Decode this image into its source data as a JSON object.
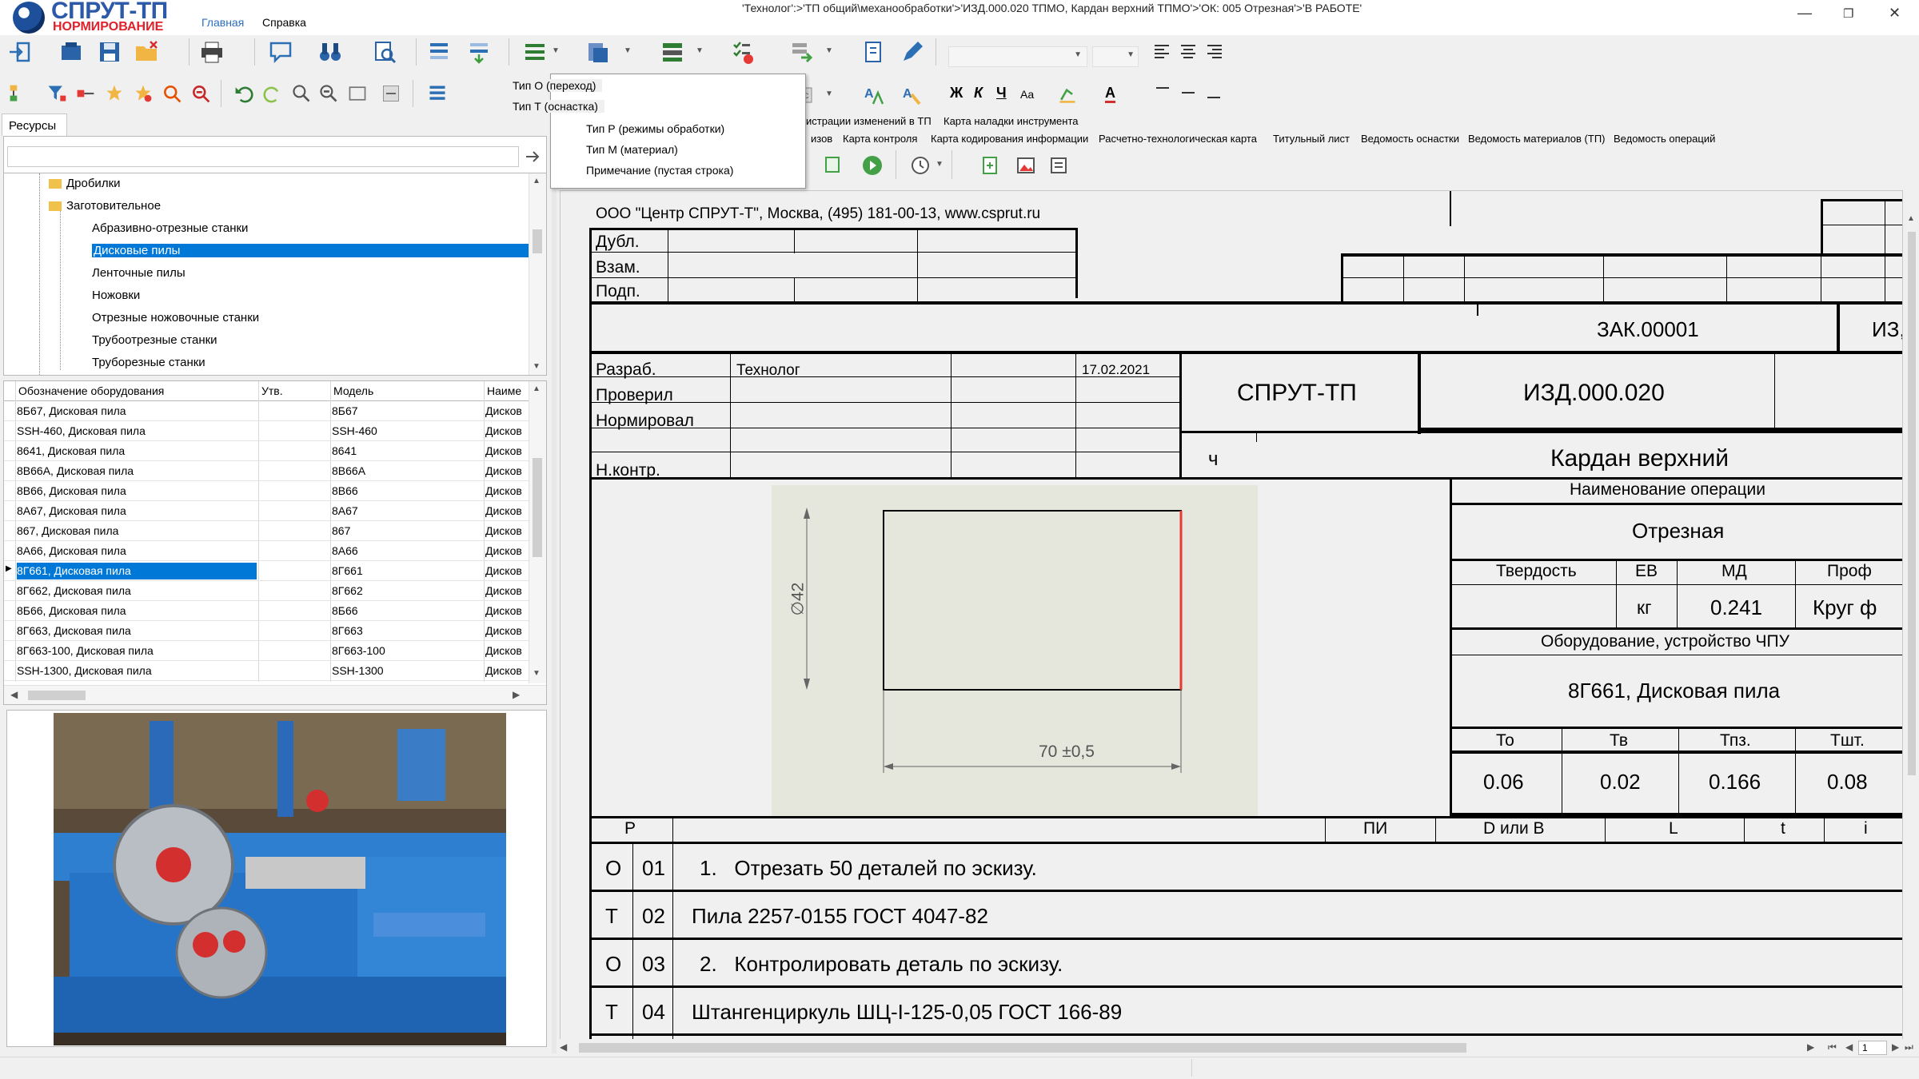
{
  "app": {
    "logo_title": "СПРУТ-ТП",
    "logo_subtitle": "НОРМИРОВАНИЕ",
    "menu": [
      "Главная",
      "Справка"
    ],
    "window_title": "'Технолог':>'ТП общий\\механообработки'>'ИЗД.000.020 ТПМО, Кардан верхний ТПМО'>'ОК: 005 Отрезная'>'В РАБОТЕ'",
    "window_controls": [
      "—",
      "❐",
      "✕"
    ]
  },
  "toolbar": {
    "format_labels": [
      "Ж",
      "К",
      "Ч",
      "Aa",
      "A"
    ]
  },
  "dropdown": {
    "items": [
      "Тип О (переход)",
      "Тип Т (оснастка)",
      "Тип Р (режимы обработки)",
      "Тип М (материал)",
      "Примечание (пустая строка)"
    ]
  },
  "tabs": {
    "row1": [
      "истрации изменений в ТП",
      "Карта наладки инструмента"
    ],
    "row2": [
      "изов",
      "Карта контроля",
      "Карта кодирования информации",
      "Расчетно-технологическая карта",
      "Титульный лист",
      "Ведомость оснастки",
      "Ведомость материалов (ТП)",
      "Ведомость операций"
    ]
  },
  "resources": {
    "tab_label": "Ресурсы",
    "search_value": "",
    "tree": [
      {
        "label": "Дробилки",
        "level": 1,
        "folder": true
      },
      {
        "label": "Заготовительное",
        "level": 1,
        "folder": true
      },
      {
        "label": "Абразивно-отрезные станки",
        "level": 2
      },
      {
        "label": "Дисковые пилы",
        "level": 2,
        "selected": true
      },
      {
        "label": "Ленточные пилы",
        "level": 2
      },
      {
        "label": "Ножовки",
        "level": 2
      },
      {
        "label": "Отрезные ножовочные станки",
        "level": 2
      },
      {
        "label": "Трубоотрезные станки",
        "level": 2
      },
      {
        "label": "Труборезные станки",
        "level": 2
      }
    ],
    "table_headers": [
      "Обозначение оборудования",
      "Утв.",
      "Модель",
      "Наиме"
    ],
    "table_rows": [
      [
        "8Б67, Дисковая пила",
        "",
        "8Б67",
        "Дисков"
      ],
      [
        "SSH-460, Дисковая пила",
        "",
        "SSH-460",
        "Дисков"
      ],
      [
        "8641, Дисковая пила",
        "",
        "8641",
        "Дисков"
      ],
      [
        "8В66А, Дисковая пила",
        "",
        "8В66А",
        "Дисков"
      ],
      [
        "8В66, Дисковая пила",
        "",
        "8В66",
        "Дисков"
      ],
      [
        "8А67, Дисковая пила",
        "",
        "8А67",
        "Дисков"
      ],
      [
        "867, Дисковая пила",
        "",
        "867",
        "Дисков"
      ],
      [
        "8А66, Дисковая пила",
        "",
        "8А66",
        "Дисков"
      ],
      [
        "8Г661, Дисковая пила",
        "",
        "8Г661",
        "Дисков"
      ],
      [
        "8Г662, Дисковая пила",
        "",
        "8Г662",
        "Дисков"
      ],
      [
        "8Б66, Дисковая пила",
        "",
        "8Б66",
        "Дисков"
      ],
      [
        "8Г663, Дисковая пила",
        "",
        "8Г663",
        "Дисков"
      ],
      [
        "8Г663-100, Дисковая пила",
        "",
        "8Г663-100",
        "Дисков"
      ],
      [
        "SSH-1300, Дисковая пила",
        "",
        "SSH-1300",
        "Дисков"
      ]
    ],
    "selected_row": 8
  },
  "form": {
    "company": "ООО \"Центр СПРУТ-Т\", Москва, (495) 181-00-13, www.csprut.ru",
    "sign_labels": [
      "Дубл.",
      "Взам.",
      "Подп."
    ],
    "order_number": "ЗАК.00001",
    "order_right": "ИЗ,",
    "people_labels": [
      "Разраб.",
      "Проверил",
      "Нормировал",
      "",
      "Н.контр."
    ],
    "developer": "Технолог",
    "date": "17.02.2021",
    "system": "СПРУТ-ТП",
    "product_code": "ИЗД.000.020",
    "letter": "ч",
    "part_name": "Кардан верхний",
    "op_name_header": "Наименование операции",
    "op_name": "Отрезная",
    "hardness_header": "Твердость",
    "unit_header": "ЕВ",
    "mass_header": "МД",
    "profile_header": "Проф",
    "unit": "кг",
    "mass": "0.241",
    "profile": "Круг ф",
    "equipment_header": "Оборудование, устройство ЧПУ",
    "equipment": "8Г661, Дисковая пила",
    "time_headers": [
      "То",
      "Тв",
      "Тпз.",
      "Тшт."
    ],
    "time_values": [
      "0.06",
      "0.02",
      "0.166",
      "0.08"
    ],
    "sketch_dim_h": "70 ±0,5",
    "sketch_dim_v": "∅42",
    "rows_header": [
      "Р",
      "ПИ",
      "D или B",
      "L",
      "t",
      "i"
    ],
    "rows": [
      {
        "type": "О",
        "num": "01",
        "text": "1.   Отрезать 50 деталей по эскизу."
      },
      {
        "type": "Т",
        "num": "02",
        "text": "Пила 2257-0155 ГОСТ 4047-82"
      },
      {
        "type": "О",
        "num": "03",
        "text": "2.   Контролировать деталь по эскизу."
      },
      {
        "type": "Т",
        "num": "04",
        "text": "Штангенциркуль ШЦ-I-125-0,05 ГОСТ 166-89"
      }
    ],
    "page_number": "1"
  }
}
